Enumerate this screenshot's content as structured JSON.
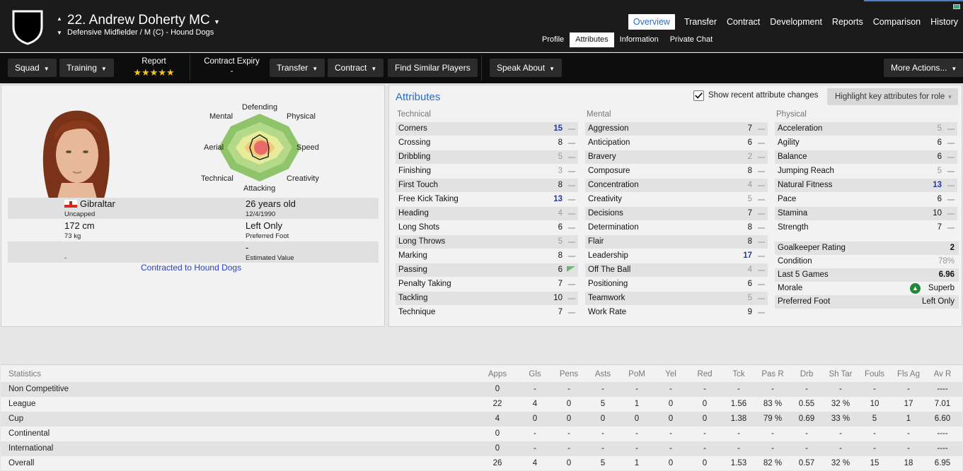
{
  "header": {
    "title": "22. Andrew Doherty MC",
    "subtitle": "Defensive Midfielder / M (C) - Hound Dogs",
    "main_tabs": [
      "Overview",
      "Transfer",
      "Contract",
      "Development",
      "Reports",
      "Comparison",
      "History"
    ],
    "sub_tabs": [
      "Profile",
      "Attributes",
      "Information",
      "Private Chat"
    ],
    "active_main_tab": "Overview",
    "active_sub_tab": "Attributes"
  },
  "toolbar": {
    "squad": "Squad",
    "training": "Training",
    "report_label": "Report",
    "report_stars": "★★★★★",
    "contract_expiry_label": "Contract Expiry",
    "contract_expiry_value": "-",
    "transfer": "Transfer",
    "contract": "Contract",
    "find_similar": "Find Similar Players",
    "speak_about": "Speak About",
    "more_actions": "More Actions..."
  },
  "profile": {
    "radar_labels": {
      "defending": "Defending",
      "physical": "Physical",
      "speed": "Speed",
      "creativity": "Creativity",
      "attacking": "Attacking",
      "technical": "Technical",
      "aerial": "Aerial",
      "mental": "Mental"
    },
    "nation": "Gibraltar",
    "caps": "Uncapped",
    "age": "26 years old",
    "dob": "12/4/1990",
    "height": "172 cm",
    "weight": "73 kg",
    "preferred_foot_value": "Left Only",
    "preferred_foot_label": "Preferred Foot",
    "value_left": "-",
    "estimated_value": "-",
    "estimated_value_label": "Estimated Value",
    "contract_status": "Contracted to Hound Dogs"
  },
  "attributes": {
    "title": "Attributes",
    "show_recent_label": "Show recent attribute changes",
    "show_recent_checked": true,
    "highlight_label": "Highlight key attributes for role",
    "technical_title": "Technical",
    "mental_title": "Mental",
    "physical_title": "Physical",
    "technical": [
      {
        "name": "Corners",
        "value": "15"
      },
      {
        "name": "Crossing",
        "value": "8"
      },
      {
        "name": "Dribbling",
        "value": "5"
      },
      {
        "name": "Finishing",
        "value": "3"
      },
      {
        "name": "First Touch",
        "value": "8"
      },
      {
        "name": "Free Kick Taking",
        "value": "13"
      },
      {
        "name": "Heading",
        "value": "4"
      },
      {
        "name": "Long Shots",
        "value": "6"
      },
      {
        "name": "Long Throws",
        "value": "5"
      },
      {
        "name": "Marking",
        "value": "8"
      },
      {
        "name": "Passing",
        "value": "6"
      },
      {
        "name": "Penalty Taking",
        "value": "7"
      },
      {
        "name": "Tackling",
        "value": "10"
      },
      {
        "name": "Technique",
        "value": "7"
      }
    ],
    "mental": [
      {
        "name": "Aggression",
        "value": "7"
      },
      {
        "name": "Anticipation",
        "value": "6"
      },
      {
        "name": "Bravery",
        "value": "2"
      },
      {
        "name": "Composure",
        "value": "8"
      },
      {
        "name": "Concentration",
        "value": "4"
      },
      {
        "name": "Creativity",
        "value": "5"
      },
      {
        "name": "Decisions",
        "value": "7"
      },
      {
        "name": "Determination",
        "value": "8"
      },
      {
        "name": "Flair",
        "value": "8"
      },
      {
        "name": "Leadership",
        "value": "17"
      },
      {
        "name": "Off The Ball",
        "value": "4"
      },
      {
        "name": "Positioning",
        "value": "6"
      },
      {
        "name": "Teamwork",
        "value": "5"
      },
      {
        "name": "Work Rate",
        "value": "9"
      }
    ],
    "physical": [
      {
        "name": "Acceleration",
        "value": "5"
      },
      {
        "name": "Agility",
        "value": "6"
      },
      {
        "name": "Balance",
        "value": "6"
      },
      {
        "name": "Jumping Reach",
        "value": "5"
      },
      {
        "name": "Natural Fitness",
        "value": "13"
      },
      {
        "name": "Pace",
        "value": "6"
      },
      {
        "name": "Stamina",
        "value": "10"
      },
      {
        "name": "Strength",
        "value": "7"
      }
    ],
    "extra": [
      {
        "name": "Goalkeeper Rating",
        "value": "2"
      },
      {
        "name": "Condition",
        "value": "78%"
      },
      {
        "name": "Last 5 Games",
        "value": "6.96"
      },
      {
        "name": "Morale",
        "value": "Superb"
      },
      {
        "name": "Preferred Foot",
        "value": "Left Only"
      }
    ]
  },
  "statistics": {
    "title": "Statistics",
    "columns": [
      "Apps",
      "Gls",
      "Pens",
      "Asts",
      "PoM",
      "Yel",
      "Red",
      "Tck",
      "Pas R",
      "Drb",
      "Sh Tar",
      "Fouls",
      "Fls Ag",
      "Av R"
    ],
    "rows": [
      {
        "label": "Non Competitive",
        "cells": [
          "0",
          "-",
          "-",
          "-",
          "-",
          "-",
          "-",
          "-",
          "-",
          "-",
          "-",
          "-",
          "-",
          "----"
        ]
      },
      {
        "label": "League",
        "cells": [
          "22",
          "4",
          "0",
          "5",
          "1",
          "0",
          "0",
          "1.56",
          "83 %",
          "0.55",
          "32 %",
          "10",
          "17",
          "7.01"
        ]
      },
      {
        "label": "Cup",
        "cells": [
          "4",
          "0",
          "0",
          "0",
          "0",
          "0",
          "0",
          "1.38",
          "79 %",
          "0.69",
          "33 %",
          "5",
          "1",
          "6.60"
        ]
      },
      {
        "label": "Continental",
        "cells": [
          "0",
          "-",
          "-",
          "-",
          "-",
          "-",
          "-",
          "-",
          "-",
          "-",
          "-",
          "-",
          "-",
          "----"
        ]
      },
      {
        "label": "International",
        "cells": [
          "0",
          "-",
          "-",
          "-",
          "-",
          "-",
          "-",
          "-",
          "-",
          "-",
          "-",
          "-",
          "-",
          "----"
        ]
      },
      {
        "label": "Overall",
        "cells": [
          "26",
          "4",
          "0",
          "5",
          "1",
          "0",
          "0",
          "1.53",
          "82 %",
          "0.57",
          "32 %",
          "15",
          "18",
          "6.95"
        ]
      }
    ]
  },
  "colors": {
    "accent": "#2a6bc4",
    "highlight_value": "#1f3aa6",
    "morale_green": "#1e8a3a"
  }
}
